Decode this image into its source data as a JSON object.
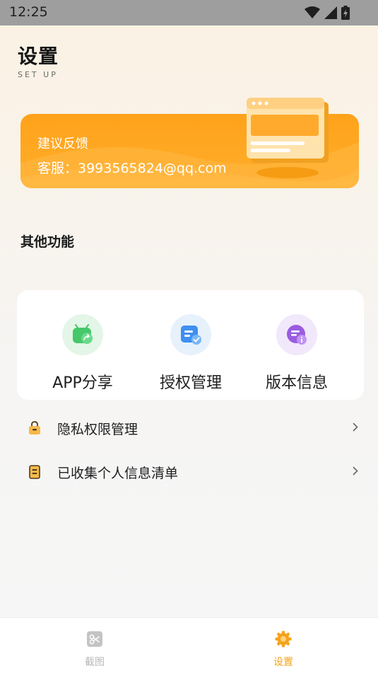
{
  "status_bar": {
    "time": "12:25",
    "icons": [
      "wifi-icon",
      "cellular-signal-icon",
      "battery-charging-icon"
    ]
  },
  "header": {
    "title": "设置",
    "subtitle": "SET UP"
  },
  "banner": {
    "title": "建议反馈",
    "contact": "客服：3993565824@qq.com",
    "accent_color": "#ffa21a"
  },
  "section": {
    "title": "其他功能"
  },
  "features": [
    {
      "label": "APP分享",
      "icon": "share-app-icon",
      "bg": "#e4f6e7",
      "color": "#46c76a"
    },
    {
      "label": "授权管理",
      "icon": "authorization-icon",
      "bg": "#e6f1fc",
      "color": "#3f8ff0"
    },
    {
      "label": "版本信息",
      "icon": "version-info-icon",
      "bg": "#f1e8fb",
      "color": "#9a5ce0"
    }
  ],
  "list": [
    {
      "label": "隐私权限管理",
      "icon": "privacy-lock-icon"
    },
    {
      "label": "已收集个人信息清单",
      "icon": "info-list-icon"
    }
  ],
  "bottom_nav": {
    "items": [
      {
        "label": "截图",
        "icon": "screenshot-icon",
        "active": false
      },
      {
        "label": "设置",
        "icon": "settings-gear-icon",
        "active": true
      }
    ],
    "active_color": "#f5a31a",
    "inactive_color": "#b8b8b8"
  }
}
